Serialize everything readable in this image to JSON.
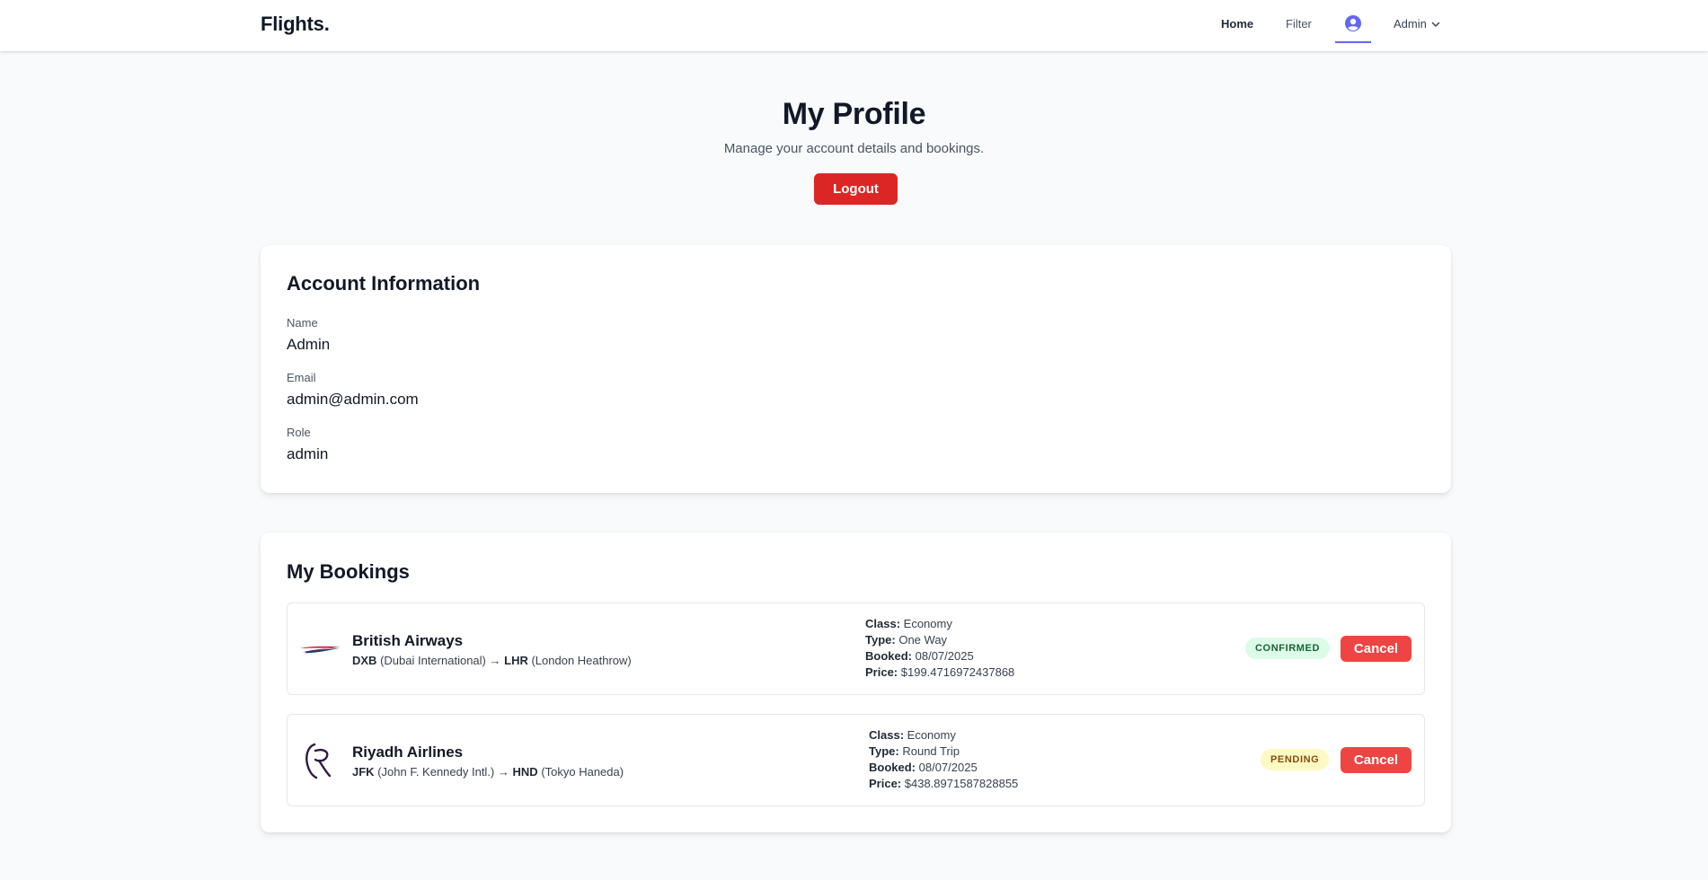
{
  "brand": "Flights.",
  "nav": {
    "home": "Home",
    "filter": "Filter",
    "user_menu": "Admin",
    "active_color": "#6366f1"
  },
  "header": {
    "title": "My Profile",
    "subtitle": "Manage your account details and bookings.",
    "logout": "Logout"
  },
  "account": {
    "title": "Account Information",
    "fields": [
      {
        "label": "Name",
        "value": "Admin"
      },
      {
        "label": "Email",
        "value": "admin@admin.com"
      },
      {
        "label": "Role",
        "value": "admin"
      }
    ]
  },
  "bookings": {
    "title": "My Bookings",
    "labels": {
      "class": "Class:",
      "type": "Type:",
      "booked": "Booked:",
      "price": "Price:"
    },
    "items": [
      {
        "airline": "British Airways",
        "logo_icon": "british-airways-logo-icon",
        "from_code": "DXB",
        "from_name": "(Dubai International)",
        "arrow": "→",
        "to_code": "LHR",
        "to_name": "(London Heathrow)",
        "class": "Economy",
        "type": "One Way",
        "booked": "08/07/2025",
        "price": "$199.4716972437868",
        "status": "CONFIRMED",
        "action": "Cancel"
      },
      {
        "airline": "Riyadh Airlines",
        "logo_icon": "riyadh-airlines-logo-icon",
        "from_code": "JFK",
        "from_name": "(John F. Kennedy Intl.)",
        "arrow": "→",
        "to_code": "HND",
        "to_name": "(Tokyo Haneda)",
        "class": "Economy",
        "type": "Round Trip",
        "booked": "08/07/2025",
        "price": "$438.8971587828855",
        "status": "PENDING",
        "action": "Cancel"
      }
    ]
  },
  "colors": {
    "logout": "#dc2626",
    "cancel": "#ef4444",
    "confirmed_bg": "#dcfce7",
    "pending_bg": "#fef9c3"
  }
}
